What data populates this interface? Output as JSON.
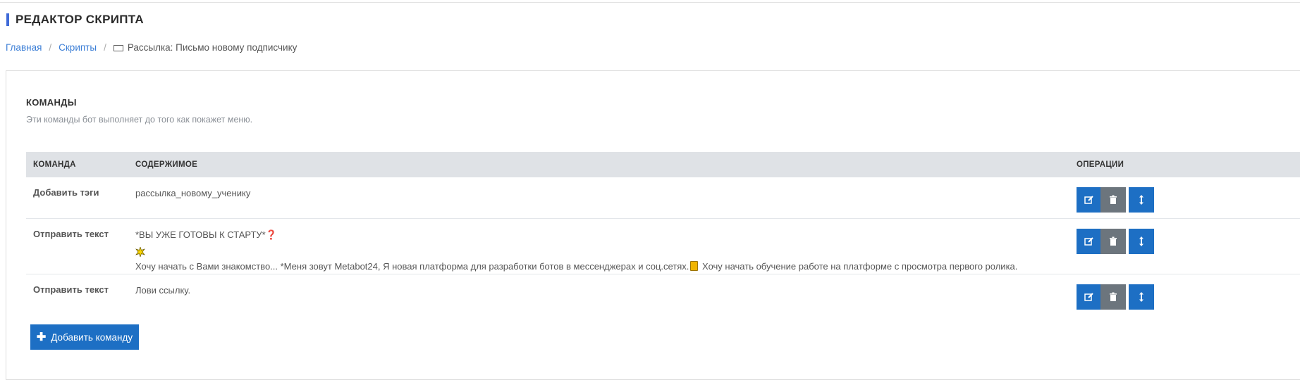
{
  "header": {
    "title": "РЕДАКТОР СКРИПТА"
  },
  "breadcrumb": {
    "home": "Главная",
    "scripts": "Скрипты",
    "current": "Рассылка: Письмо новому подписчику",
    "current_icon": "envelope-icon"
  },
  "section": {
    "title": "КОМАНДЫ",
    "description": "Эти команды бот выполняет до того как покажет меню."
  },
  "table": {
    "headers": {
      "command": "КОМАНДА",
      "content": "СОДЕРЖИМОЕ",
      "operations": "ОПЕРАЦИИ"
    },
    "rows": [
      {
        "command": "Добавить тэги",
        "content": "рассылка_новому_ученику"
      },
      {
        "command": "Отправить текст",
        "line1": "*ВЫ УЖЕ ГОТОВЫ К СТАРТУ*",
        "line1_emoji": "❓",
        "line3a": "Хочу начать с Вами знакомство... *Меня зовут Metabot24, Я новая платформа для разработки ботов в мессенджерах и соц.сетях.",
        "line3b": "Хочу начать обучение работе на платформе с просмотра первого ролика."
      },
      {
        "command": "Отправить текст",
        "content": "Лови ссылку."
      }
    ],
    "op_icons": [
      "edit-icon",
      "trash-icon",
      "move-vertical-icon"
    ]
  },
  "add_button": {
    "label": "Добавить команду",
    "icon": "plus-icon"
  },
  "colors": {
    "accent": "#3f6ad8",
    "primary": "#1d6fc4",
    "secondary": "#6c757d",
    "header_bg": "#dfe2e6",
    "link": "#3b7ed6"
  }
}
